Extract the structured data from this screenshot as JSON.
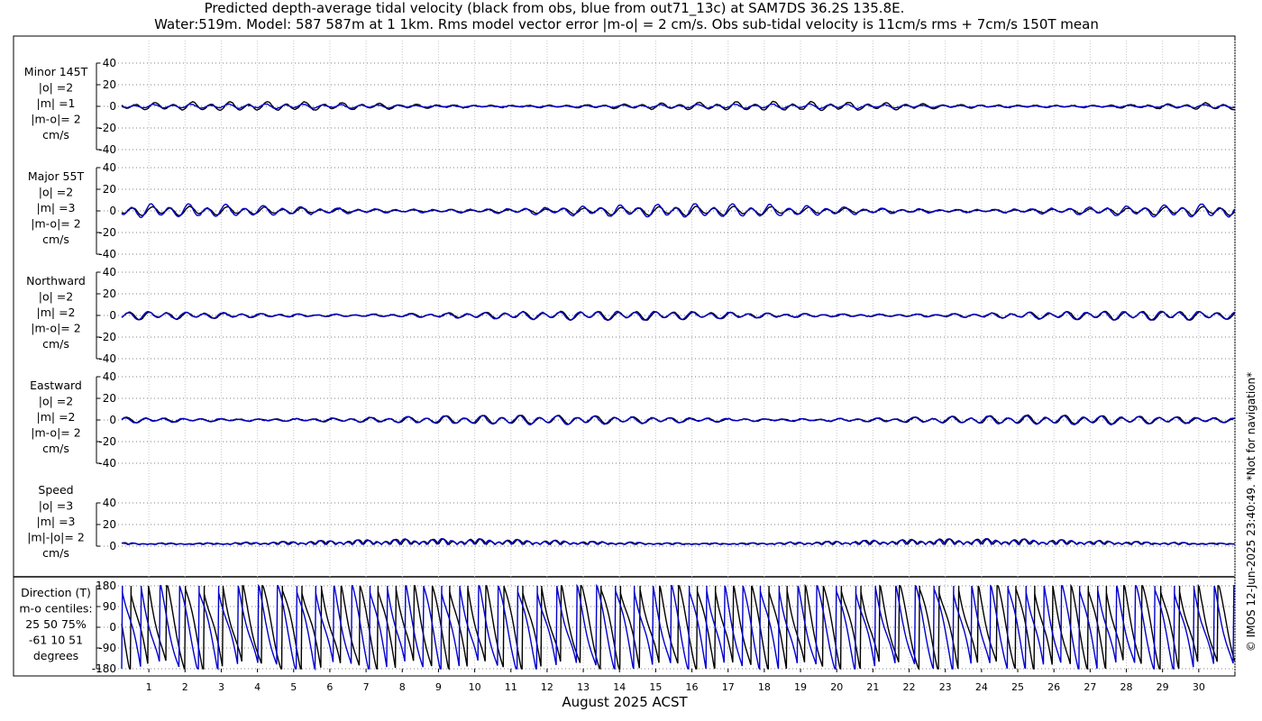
{
  "titles": {
    "line1": "Predicted depth-average tidal velocity (black from obs, blue from out71_13c) at SAM7DS 36.2S 135.8E.",
    "line2": "Water:519m. Model: 587 587m at 1 1km. Rms model vector error |m-o| = 2 cm/s. Obs sub-tidal velocity is 11cm/s rms + 7cm/s 150T mean"
  },
  "copyright": "© IMOS 12-Jun-2025 23:40:49. *Not for navigation*",
  "chart_data": {
    "type": "line",
    "xlabel": "August 2025 ACST",
    "x_ticks": [
      "1",
      "2",
      "3",
      "4",
      "5",
      "6",
      "7",
      "8",
      "9",
      "10",
      "11",
      "12",
      "13",
      "14",
      "15",
      "16",
      "17",
      "18",
      "19",
      "20",
      "21",
      "22",
      "23",
      "24",
      "25",
      "26",
      "27",
      "28",
      "29",
      "30"
    ],
    "xlim_days": [
      0.25,
      31.0
    ],
    "grid": true,
    "series_colors": {
      "obs": "#000000",
      "model": "#0000cc"
    },
    "panels": [
      {
        "key": "minor",
        "label_lines": [
          "Minor 145T",
          "|o| =2",
          "|m| =1",
          "|m-o|= 2",
          "cm/s"
        ],
        "ylim": [
          -40,
          40
        ],
        "yticks": [
          "40",
          "20",
          "0",
          "-20",
          "-40"
        ],
        "obs_amplitude": 2,
        "model_amplitude": 1
      },
      {
        "key": "major",
        "label_lines": [
          "Major 55T",
          "|o| =2",
          "|m| =3",
          "|m-o|= 2",
          "cm/s"
        ],
        "ylim": [
          -40,
          40
        ],
        "yticks": [
          "40",
          "20",
          "0",
          "-20",
          "-40"
        ],
        "obs_amplitude": 2,
        "model_amplitude": 3
      },
      {
        "key": "north",
        "label_lines": [
          "Northward",
          "|o| =2",
          "|m| =2",
          "|m-o|= 2",
          "cm/s"
        ],
        "ylim": [
          -40,
          40
        ],
        "yticks": [
          "40",
          "20",
          "0",
          "-20",
          "-40"
        ],
        "obs_amplitude": 2,
        "model_amplitude": 2
      },
      {
        "key": "east",
        "label_lines": [
          "Eastward",
          "|o| =2",
          "|m| =2",
          "|m-o|= 2",
          "cm/s"
        ],
        "ylim": [
          -40,
          40
        ],
        "yticks": [
          "40",
          "20",
          "0",
          "-20",
          "-40"
        ],
        "obs_amplitude": 2,
        "model_amplitude": 2
      },
      {
        "key": "speed",
        "label_lines": [
          "Speed",
          "|o| =3",
          "|m| =3",
          "|m|-|o|= 2",
          "cm/s"
        ],
        "ylim": [
          0,
          40
        ],
        "yticks": [
          "40",
          "20",
          "0"
        ],
        "obs_amplitude": 3,
        "model_amplitude": 3
      },
      {
        "key": "direction",
        "label_lines": [
          "Direction (T)",
          "m-o centiles:",
          "25  50  75%",
          "-61  10  51",
          "degrees"
        ],
        "ylim": [
          -180,
          180
        ],
        "yticks": [
          "180",
          "90",
          "0",
          "-90",
          "-180"
        ]
      }
    ]
  }
}
